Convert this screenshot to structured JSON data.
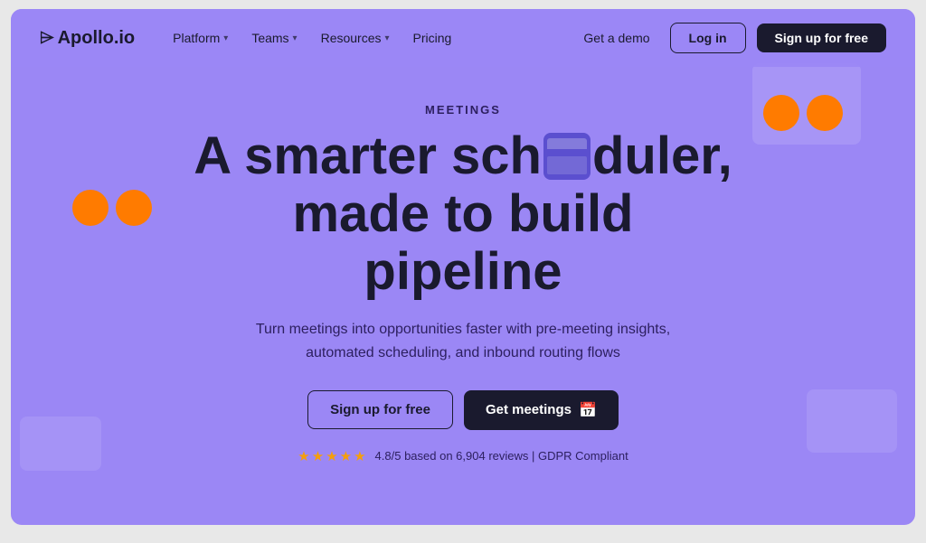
{
  "page": {
    "background_color": "#9b87f5"
  },
  "navbar": {
    "logo_text": "Apollo.io",
    "nav_items": [
      {
        "label": "Platform",
        "has_dropdown": true
      },
      {
        "label": "Teams",
        "has_dropdown": true
      },
      {
        "label": "Resources",
        "has_dropdown": true
      },
      {
        "label": "Pricing",
        "has_dropdown": false
      }
    ],
    "get_demo_label": "Get a demo",
    "login_label": "Log in",
    "signup_label": "Sign up for free"
  },
  "hero": {
    "section_label": "MEETINGS",
    "headline_part1": "A smarter sch",
    "headline_part2": "duler,",
    "headline_line2": "made to build",
    "headline_line3": "pipeline",
    "subheadline": "Turn meetings into opportunities faster with pre-meeting insights, automated scheduling, and inbound routing flows",
    "cta_signup_label": "Sign up for free",
    "cta_meetings_label": "Get meetings",
    "rating_stars": "★★★★★",
    "rating_score": "4.8",
    "rating_count": "6,904",
    "rating_text": "4.8/5 based on 6,904 reviews | GDPR Compliant"
  }
}
